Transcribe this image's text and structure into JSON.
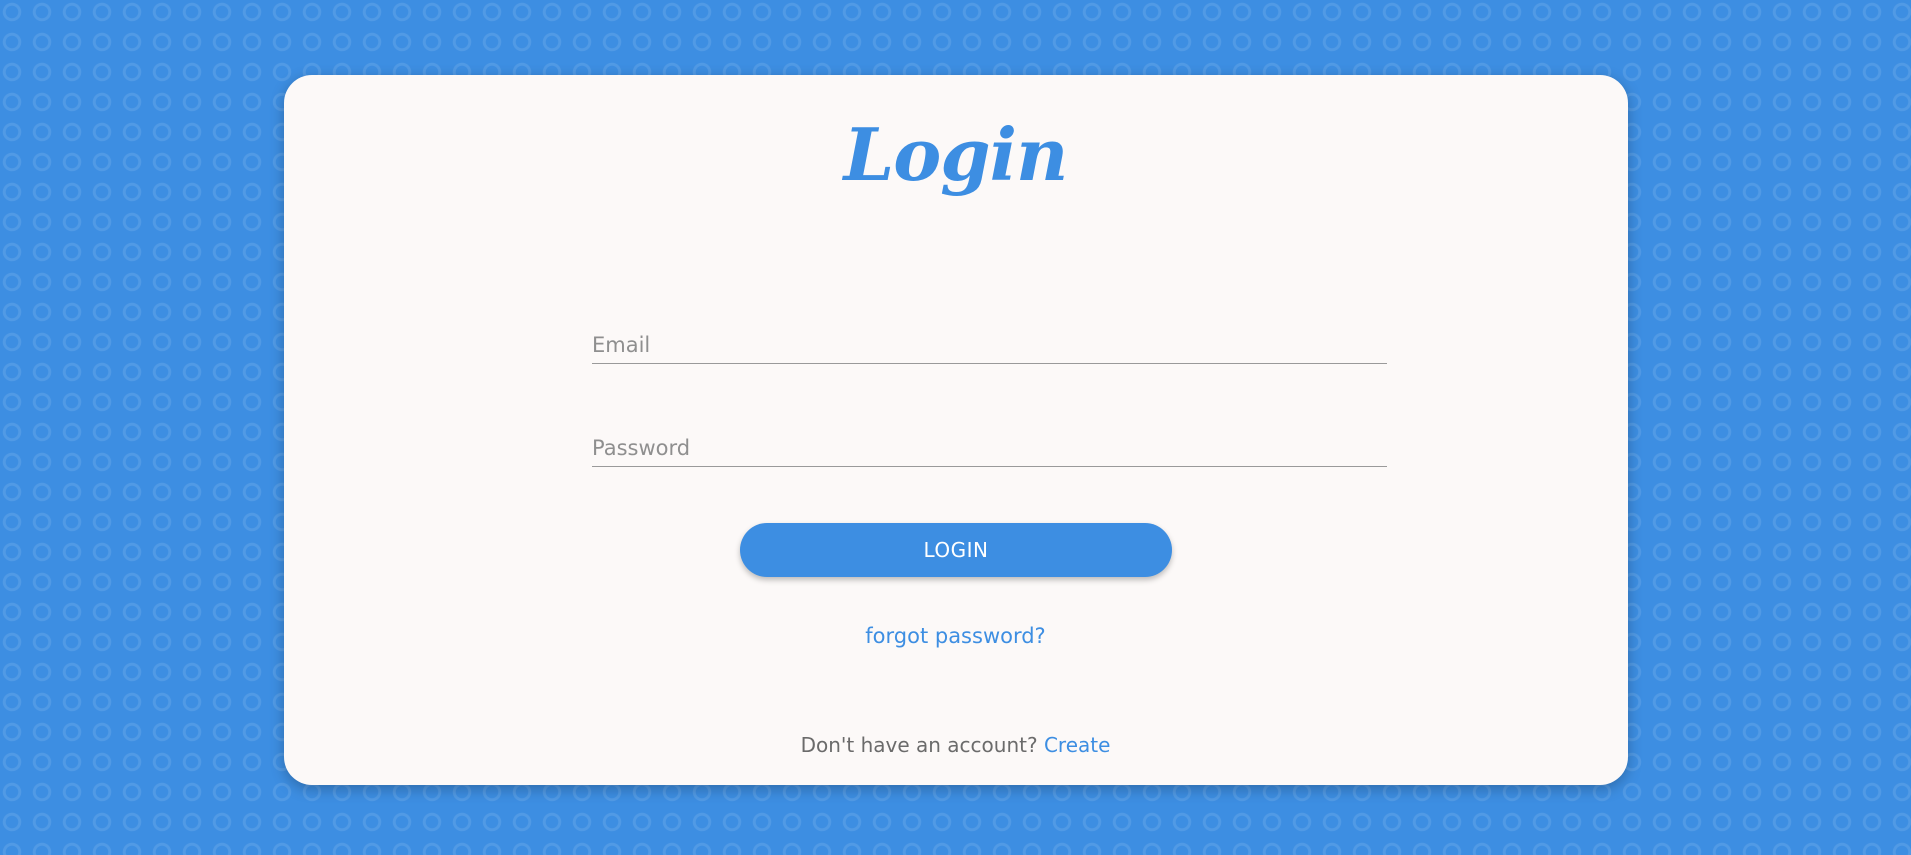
{
  "login_form": {
    "title": "Login",
    "email": {
      "placeholder": "Email",
      "value": ""
    },
    "password": {
      "placeholder": "Password",
      "value": ""
    },
    "submit_label": "LOGIN",
    "forgot_link": "forgot password?",
    "signup_prompt": "Don't have an account?",
    "signup_link": "Create"
  },
  "colors": {
    "accent": "#3d8ee2",
    "card_background": "#fcf9f8",
    "page_background": "#3d8ee2"
  }
}
